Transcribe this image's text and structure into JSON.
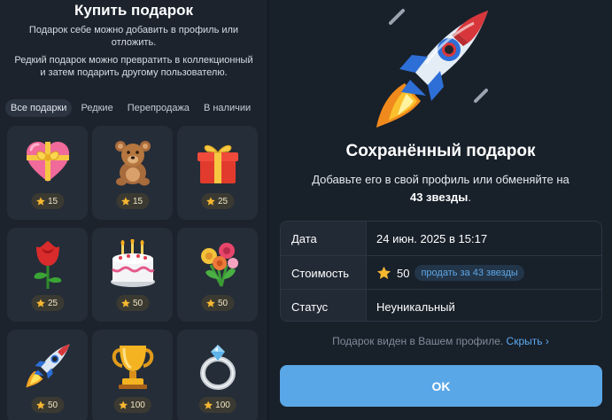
{
  "left": {
    "title": "Купить подарок",
    "desc1": "Подарок себе можно добавить в профиль или отложить.",
    "desc2": "Редкий подарок можно превратить в коллекционный и затем подарить другому пользователю.",
    "tabs": [
      "Все подарки",
      "Редкие",
      "Перепродажа",
      "В наличии"
    ],
    "gifts": [
      {
        "name": "heart",
        "price": "15"
      },
      {
        "name": "teddy-bear",
        "price": "15"
      },
      {
        "name": "gift-box",
        "price": "25"
      },
      {
        "name": "rose",
        "price": "25"
      },
      {
        "name": "cake",
        "price": "50"
      },
      {
        "name": "bouquet",
        "price": "50"
      },
      {
        "name": "rocket",
        "price": "50"
      },
      {
        "name": "trophy",
        "price": "100"
      },
      {
        "name": "ring",
        "price": "100"
      }
    ]
  },
  "right": {
    "title": "Сохранённый подарок",
    "desc_line": "Добавьте его в свой профиль или обменяйте на",
    "desc_bold": "43 звезды",
    "desc_end": ".",
    "rows": [
      {
        "key": "Дата",
        "value": "24 июн. 2025 в 15:17"
      },
      {
        "key": "Стоимость",
        "value": "50",
        "action": "продать за 43 звезды"
      },
      {
        "key": "Статус",
        "value": "Неуникальный"
      }
    ],
    "note": "Подарок виден в Вашем профиле.",
    "note_link": "Скрыть ›",
    "ok_label": "OK"
  },
  "colors": {
    "accent": "#5aa7e7",
    "link": "#5eaaf0",
    "star": "#f7b731"
  }
}
